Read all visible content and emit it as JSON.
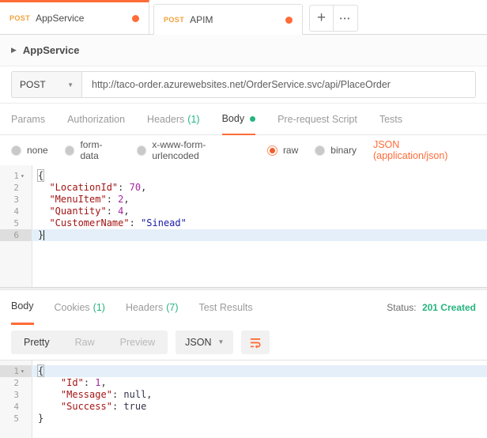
{
  "colors": {
    "accent_orange": "#FF6C37",
    "green": "#26B47F",
    "method_amber": "#F2A13C"
  },
  "tabbar": {
    "tabs": [
      {
        "method": "POST",
        "title": "AppService",
        "active": true,
        "dirty": true
      },
      {
        "method": "POST",
        "title": "APIM",
        "active": false,
        "dirty": true
      }
    ],
    "add_label": "+",
    "more_label": "•••"
  },
  "collection": {
    "caret": "▶",
    "name": "AppService"
  },
  "request": {
    "method": "POST",
    "method_chevron": "▼",
    "url": "http://taco-order.azurewebsites.net/OrderService.svc/api/PlaceOrder",
    "tabs": [
      {
        "label": "Params"
      },
      {
        "label": "Authorization"
      },
      {
        "label": "Headers",
        "count": "(1)"
      },
      {
        "label": "Body",
        "active": true,
        "dot": true
      },
      {
        "label": "Pre-request Script"
      },
      {
        "label": "Tests"
      }
    ],
    "body_modes": [
      {
        "label": "none"
      },
      {
        "label": "form-data"
      },
      {
        "label": "x-www-form-urlencoded"
      },
      {
        "label": "raw",
        "selected": true
      },
      {
        "label": "binary"
      }
    ],
    "content_type": "JSON (application/json)",
    "body_lines": [
      {
        "n": "1",
        "fold": "▾",
        "tokens": [
          {
            "t": "{",
            "c": "brace"
          }
        ]
      },
      {
        "n": "2",
        "tokens": [
          {
            "t": "  "
          },
          {
            "t": "\"LocationId\"",
            "c": "key"
          },
          {
            "t": ": "
          },
          {
            "t": "70",
            "c": "num"
          },
          {
            "t": ","
          }
        ]
      },
      {
        "n": "3",
        "tokens": [
          {
            "t": "  "
          },
          {
            "t": "\"MenuItem\"",
            "c": "key"
          },
          {
            "t": ": "
          },
          {
            "t": "2",
            "c": "num"
          },
          {
            "t": ","
          }
        ]
      },
      {
        "n": "4",
        "tokens": [
          {
            "t": "  "
          },
          {
            "t": "\"Quantity\"",
            "c": "key"
          },
          {
            "t": ": "
          },
          {
            "t": "4",
            "c": "num"
          },
          {
            "t": ","
          }
        ]
      },
      {
        "n": "5",
        "tokens": [
          {
            "t": "  "
          },
          {
            "t": "\"CustomerName\"",
            "c": "key"
          },
          {
            "t": ": "
          },
          {
            "t": "\"Sinead\"",
            "c": "str"
          }
        ]
      },
      {
        "n": "6",
        "active": true,
        "cursor": true,
        "tokens": [
          {
            "t": "}"
          }
        ]
      }
    ]
  },
  "response": {
    "tabs": [
      {
        "label": "Body",
        "active": true
      },
      {
        "label": "Cookies",
        "count": "(1)"
      },
      {
        "label": "Headers",
        "count": "(7)"
      },
      {
        "label": "Test Results"
      }
    ],
    "status_label": "Status:",
    "status_value": "201 Created",
    "view_modes": [
      {
        "label": "Pretty",
        "active": true
      },
      {
        "label": "Raw"
      },
      {
        "label": "Preview"
      }
    ],
    "language": "JSON",
    "language_chevron": "▼",
    "body_lines": [
      {
        "n": "1",
        "fold": "▾",
        "active": true,
        "tokens": [
          {
            "t": "{",
            "c": "brace"
          }
        ]
      },
      {
        "n": "2",
        "tokens": [
          {
            "t": "    "
          },
          {
            "t": "\"Id\"",
            "c": "key"
          },
          {
            "t": ": "
          },
          {
            "t": "1",
            "c": "num"
          },
          {
            "t": ","
          }
        ]
      },
      {
        "n": "3",
        "tokens": [
          {
            "t": "    "
          },
          {
            "t": "\"Message\"",
            "c": "key"
          },
          {
            "t": ": "
          },
          {
            "t": "null",
            "c": "atom"
          },
          {
            "t": ","
          }
        ]
      },
      {
        "n": "4",
        "tokens": [
          {
            "t": "    "
          },
          {
            "t": "\"Success\"",
            "c": "key"
          },
          {
            "t": ": "
          },
          {
            "t": "true",
            "c": "atom"
          }
        ]
      },
      {
        "n": "5",
        "tokens": [
          {
            "t": "}"
          }
        ]
      }
    ]
  }
}
